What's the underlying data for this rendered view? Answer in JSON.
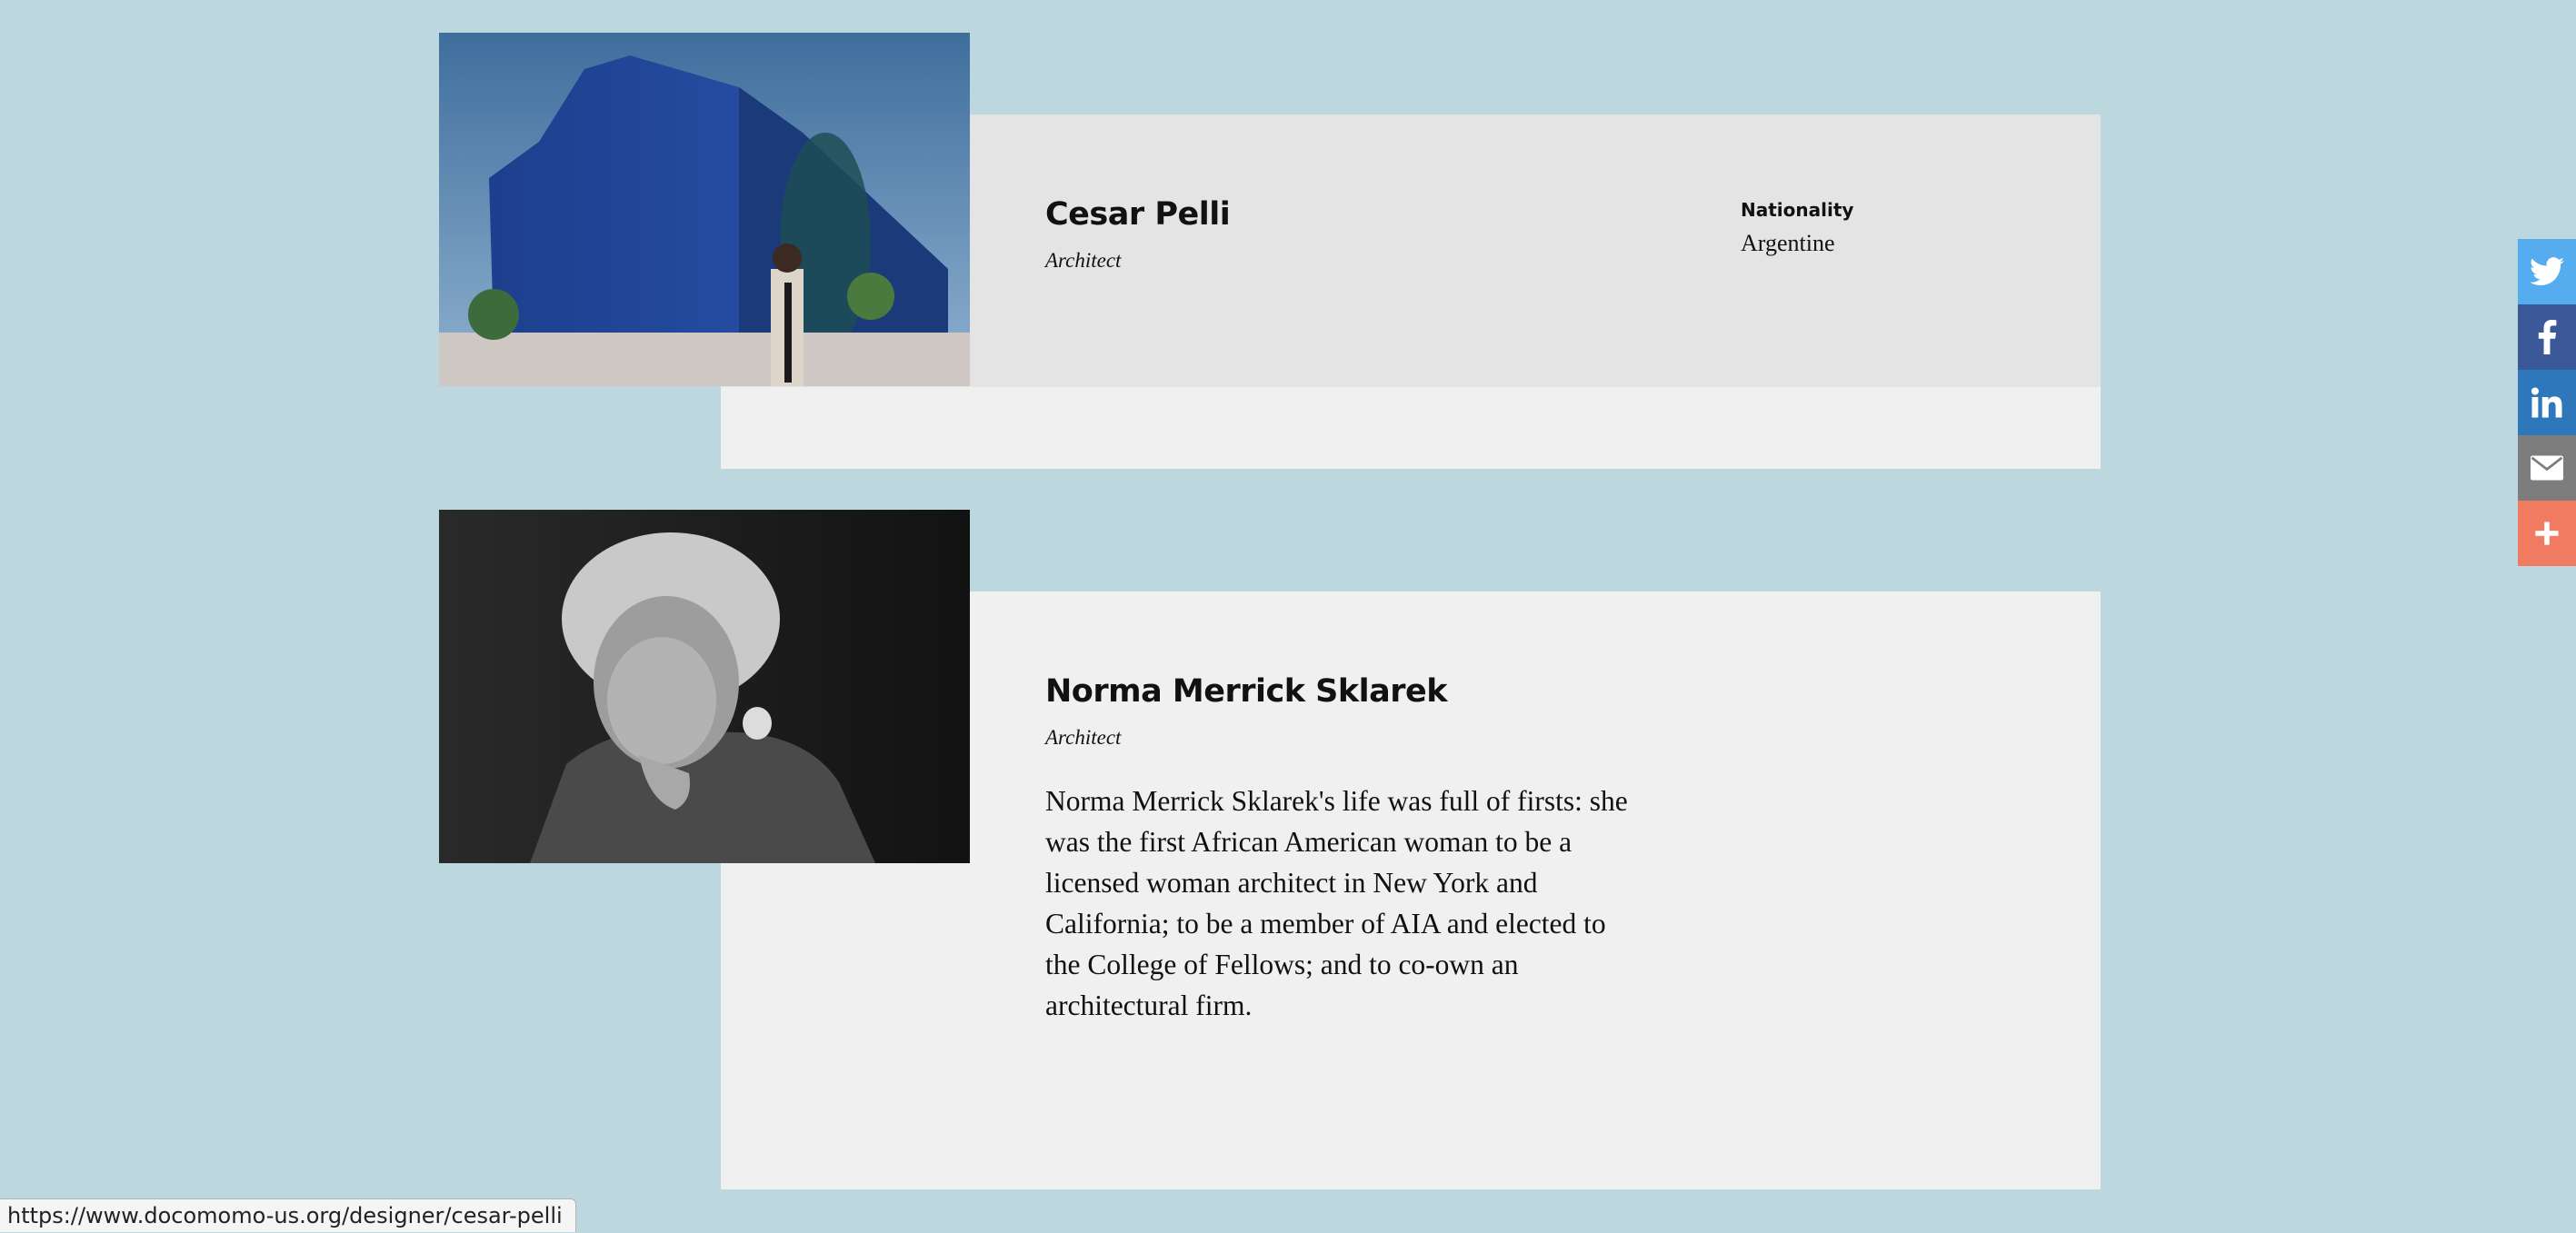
{
  "designers": [
    {
      "name": "Cesar Pelli",
      "role": "Architect",
      "nationality_label": "Nationality",
      "nationality": "Argentine",
      "photo_icon": "building-photo"
    },
    {
      "name": "Norma Merrick Sklarek",
      "role": "Architect",
      "bio": "Norma Merrick Sklarek's life was full of firsts: she was the first African American woman to be a licensed woman architect in New York and California; to be a member of AIA and elected to the College of Fellows; and to co-own an architectural firm.",
      "photo_icon": "portrait-photo"
    }
  ],
  "share_bar": [
    {
      "icon": "twitter-icon",
      "color": "#55acee"
    },
    {
      "icon": "facebook-icon",
      "color": "#3b5998"
    },
    {
      "icon": "linkedin-icon",
      "color": "#2e77bb"
    },
    {
      "icon": "email-icon",
      "color": "#7d7d7d"
    },
    {
      "icon": "plus-icon",
      "color": "#f17b61"
    }
  ],
  "status_url": "https://www.docomomo-us.org/designer/cesar-pelli"
}
